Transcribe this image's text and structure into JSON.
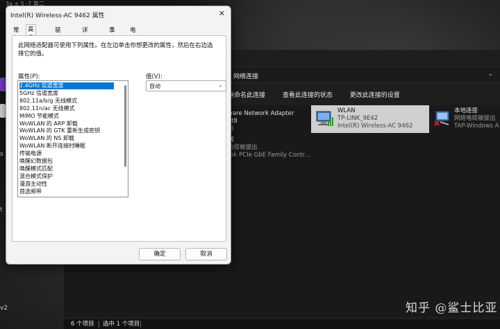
{
  "desktop": {
    "left_labels": [
      "s",
      "t",
      "v2"
    ],
    "top_fragment": "3a  ± 5  -7 第二"
  },
  "network_window": {
    "breadcrumb": "网络连接",
    "commands": [
      "重命名此连接",
      "查看此连接的状态",
      "更改此连接的设置"
    ],
    "adapters": [
      {
        "name": "ware Network Adapter",
        "line2": "et8",
        "line3": "用"
      },
      {
        "name": "WLAN",
        "line2": "TP-LINK_9E42",
        "line3": "Intel(R) Wireless-AC 9462",
        "selected": true
      },
      {
        "name": "本地连接",
        "line2": "网络电缆被拔出",
        "line3": "TAP-Windows A"
      },
      {
        "name": "网",
        "line2": "电缆被拔出",
        "line3": "tek PCIe GbE Family Contr..."
      }
    ],
    "status": {
      "items": "6 个项目",
      "selected": "选中 1 个项目"
    },
    "watermark": "知乎 @鲨士比亚"
  },
  "dialog": {
    "title": "Intel(R) Wireless-AC 9462 属性",
    "tabs": [
      "常规",
      "高级",
      "驱动程序",
      "详细信息",
      "事件",
      "电源管理"
    ],
    "active_tab": "高级",
    "description": "此网络适配器可使用下列属性。在左边单击你想更改的属性，然后在右边选择它的值。",
    "property_label": "属性(P):",
    "value_label": "值(V):",
    "properties": [
      "2.4GHz 信道宽度",
      "5GHz 信道宽度",
      "802.11a/b/g 无线模式",
      "802.11n/ac 无线模式",
      "MIMO 节能模式",
      "WoWLAN 的 ARP 卸载",
      "WoWLAN 的 GTK 重新生成密钥",
      "WoWLAN 的 NS 卸载",
      "WoWLAN 断开连接时睡眠",
      "传输电源",
      "唤醒幻数据包",
      "唤醒模式匹配",
      "混合模式保护",
      "漫游主动性",
      "首选频带"
    ],
    "selected_property": "2.4GHz 信道宽度",
    "value": "自动",
    "ok_label": "确定",
    "cancel_label": "取消"
  }
}
